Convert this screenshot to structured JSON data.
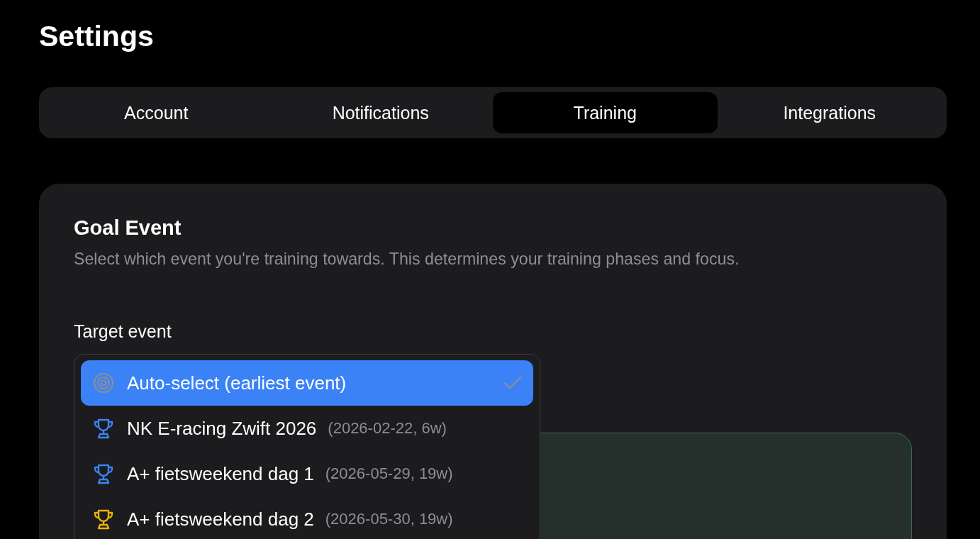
{
  "page": {
    "title": "Settings"
  },
  "tabs": [
    {
      "label": "Account",
      "selected": false
    },
    {
      "label": "Notifications",
      "selected": false
    },
    {
      "label": "Training",
      "selected": true
    },
    {
      "label": "Integrations",
      "selected": false
    }
  ],
  "goal_event": {
    "heading": "Goal Event",
    "description": "Select which event you're training towards. This determines your training phases and focus.",
    "field_label": "Target event",
    "options": [
      {
        "kind": "auto",
        "label": "Auto-select (earliest event)",
        "selected": true
      },
      {
        "kind": "event",
        "label": "NK E-racing Zwift 2026",
        "meta": "(2026-02-22, 6w)",
        "color": "#3b82f6",
        "selected": false
      },
      {
        "kind": "event",
        "label": "A+ fietsweekend dag 1",
        "meta": "(2026-05-29, 19w)",
        "color": "#3b82f6",
        "selected": false
      },
      {
        "kind": "event",
        "label": "A+ fietsweekend dag 2",
        "meta": "(2026-05-30, 19w)",
        "color": "#eab308",
        "selected": false
      }
    ]
  }
}
